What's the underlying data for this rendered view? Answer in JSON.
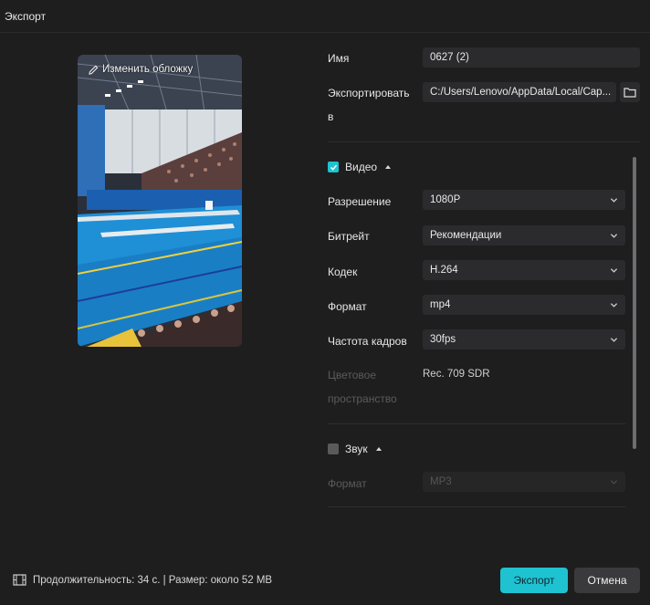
{
  "window": {
    "title": "Экспорт"
  },
  "preview": {
    "change_cover_label": "Изменить обложку"
  },
  "general": {
    "name_label": "Имя",
    "name_value": "0627 (2)",
    "export_to_label_line1": "Экспортировать",
    "export_to_label_line2": "в",
    "export_path": "C:/Users/Lenovo/AppData/Local/Cap..."
  },
  "video": {
    "section_label": "Видео",
    "enabled": true,
    "resolution_label": "Разрешение",
    "resolution_value": "1080P",
    "bitrate_label": "Битрейт",
    "bitrate_value": "Рекомендации",
    "codec_label": "Кодек",
    "codec_value": "H.264",
    "format_label": "Формат",
    "format_value": "mp4",
    "framerate_label": "Частота кадров",
    "framerate_value": "30fps",
    "colorspace_label_line1": "Цветовое",
    "colorspace_label_line2": "пространство",
    "colorspace_value": "Rec. 709 SDR"
  },
  "audio": {
    "section_label": "Звук",
    "enabled": false,
    "format_label": "Формат",
    "format_value": "MP3"
  },
  "footer": {
    "info": "Продолжительность: 34 с. | Размер: около 52 MB",
    "export_button": "Экспорт",
    "cancel_button": "Отмена"
  },
  "colors": {
    "accent": "#1fc2d1",
    "background": "#1e1e1f",
    "field": "#2b2b2d"
  }
}
